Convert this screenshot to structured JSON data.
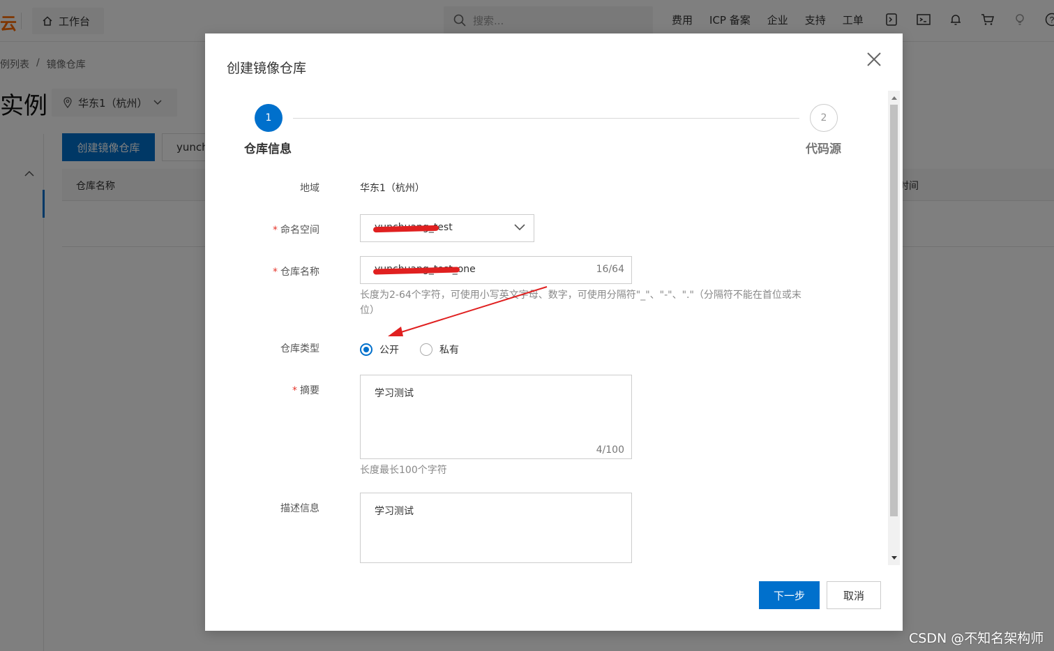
{
  "topbar": {
    "logo": "云",
    "workbench_label": "工作台",
    "search_placeholder": "搜索...",
    "nav": [
      "费用",
      "ICP 备案",
      "企业",
      "支持",
      "工单"
    ]
  },
  "breadcrumb": [
    "例列表",
    "/",
    "镜像仓库"
  ],
  "page_title": "实例",
  "region_select": "华东1（杭州）",
  "background": {
    "create_button": "创建镜像仓库",
    "filter_text": "yunch",
    "table_headers": [
      "仓库名称",
      "时间"
    ]
  },
  "dialog": {
    "title": "创建镜像仓库",
    "steps": [
      {
        "number": "1",
        "label": "仓库信息",
        "status": "active"
      },
      {
        "number": "2",
        "label": "代码源",
        "status": "pending"
      }
    ],
    "form": {
      "region_label": "地域",
      "region_value": "华东1（杭州）",
      "namespace_label": "命名空间",
      "namespace_value": "yunchuang_test",
      "repo_name_label": "仓库名称",
      "repo_name_value": "yunchuang_test_one",
      "repo_name_counter": "16/64",
      "repo_name_hint": "长度为2-64个字符，可使用小写英文字母、数字，可使用分隔符\"_\"、\"-\"、\".\"（分隔符不能在首位或末位）",
      "repo_type_label": "仓库类型",
      "repo_type_options": [
        "公开",
        "私有"
      ],
      "repo_type_selected": "公开",
      "summary_label": "摘要",
      "summary_value": "学习测试",
      "summary_counter": "4/100",
      "summary_hint": "长度最长100个字符",
      "description_label": "描述信息",
      "description_value": "学习测试"
    },
    "buttons": {
      "next": "下一步",
      "cancel": "取消"
    }
  },
  "watermark": "CSDN @不知名架构师",
  "colors": {
    "primary": "#0070cc",
    "required": "#e5352b",
    "annotation_arrow": "#e02020"
  }
}
